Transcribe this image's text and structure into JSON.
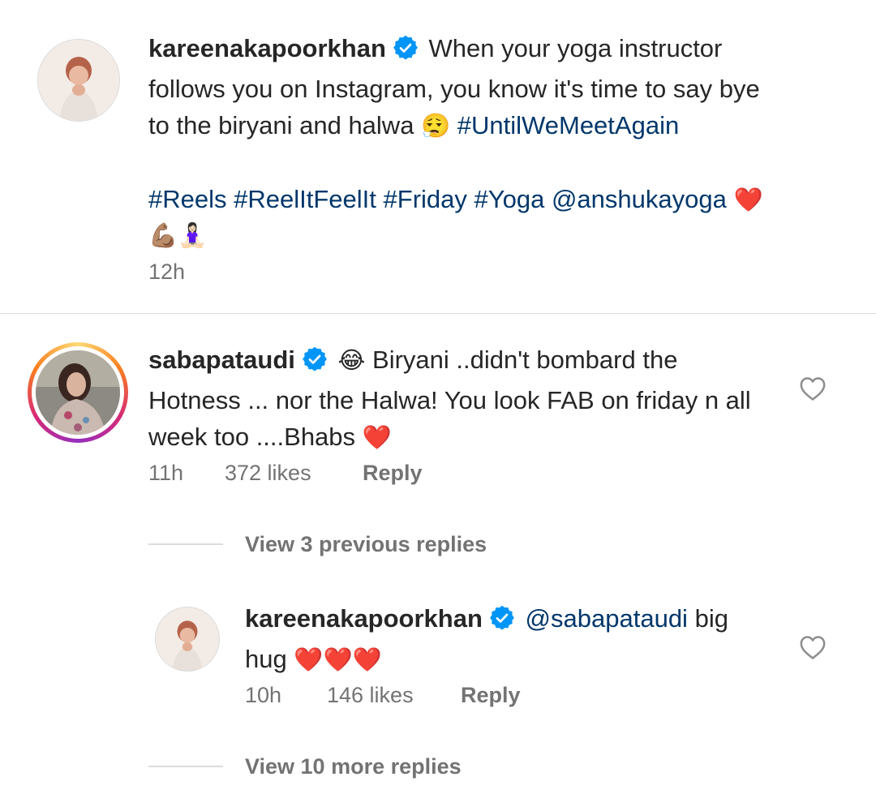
{
  "caption": {
    "username": "kareenakapoorkhan",
    "text_line1": "When your yoga instructor",
    "text_line2": "follows you on Instagram, you know it's time to say bye",
    "text_line3_prefix": "to the biryani and halwa",
    "text_line3_emoji": "😮‍💨",
    "hashtag_until": "#UntilWeMeetAgain",
    "tags": [
      "#Reels",
      "#ReelItFeelIt",
      "#Friday",
      "#Yoga"
    ],
    "mention": "@anshukayoga",
    "heart_emoji": "❤️",
    "emoji_line": "💪🏽🧘🏻‍♀️",
    "time": "12h"
  },
  "comment1": {
    "username": "sabapataudi",
    "laugh_emoji": "😂",
    "line1": "Biryani ..didn't bombard the",
    "line2": "Hotness ... nor the Halwa! You look FAB on friday n all",
    "line3": "week too ....Bhabs",
    "heart_emoji": "❤️",
    "time": "11h",
    "likes": "372 likes",
    "reply_label": "Reply"
  },
  "view_previous": "View 3 previous replies",
  "reply1": {
    "username": "kareenakapoorkhan",
    "mention": "@sabapataudi",
    "text_after_mention": "big",
    "line2_text": "hug",
    "hearts": "❤️❤️❤️",
    "time": "10h",
    "likes": "146 likes",
    "reply_label": "Reply"
  },
  "view_more": "View 10 more replies",
  "colors": {
    "link": "#00376b",
    "verified": "#0095f6",
    "secondary_text": "#737373",
    "divider": "#dbdbdb"
  },
  "icons": {
    "verified": "verified-badge-icon",
    "like": "heart-outline-icon"
  }
}
